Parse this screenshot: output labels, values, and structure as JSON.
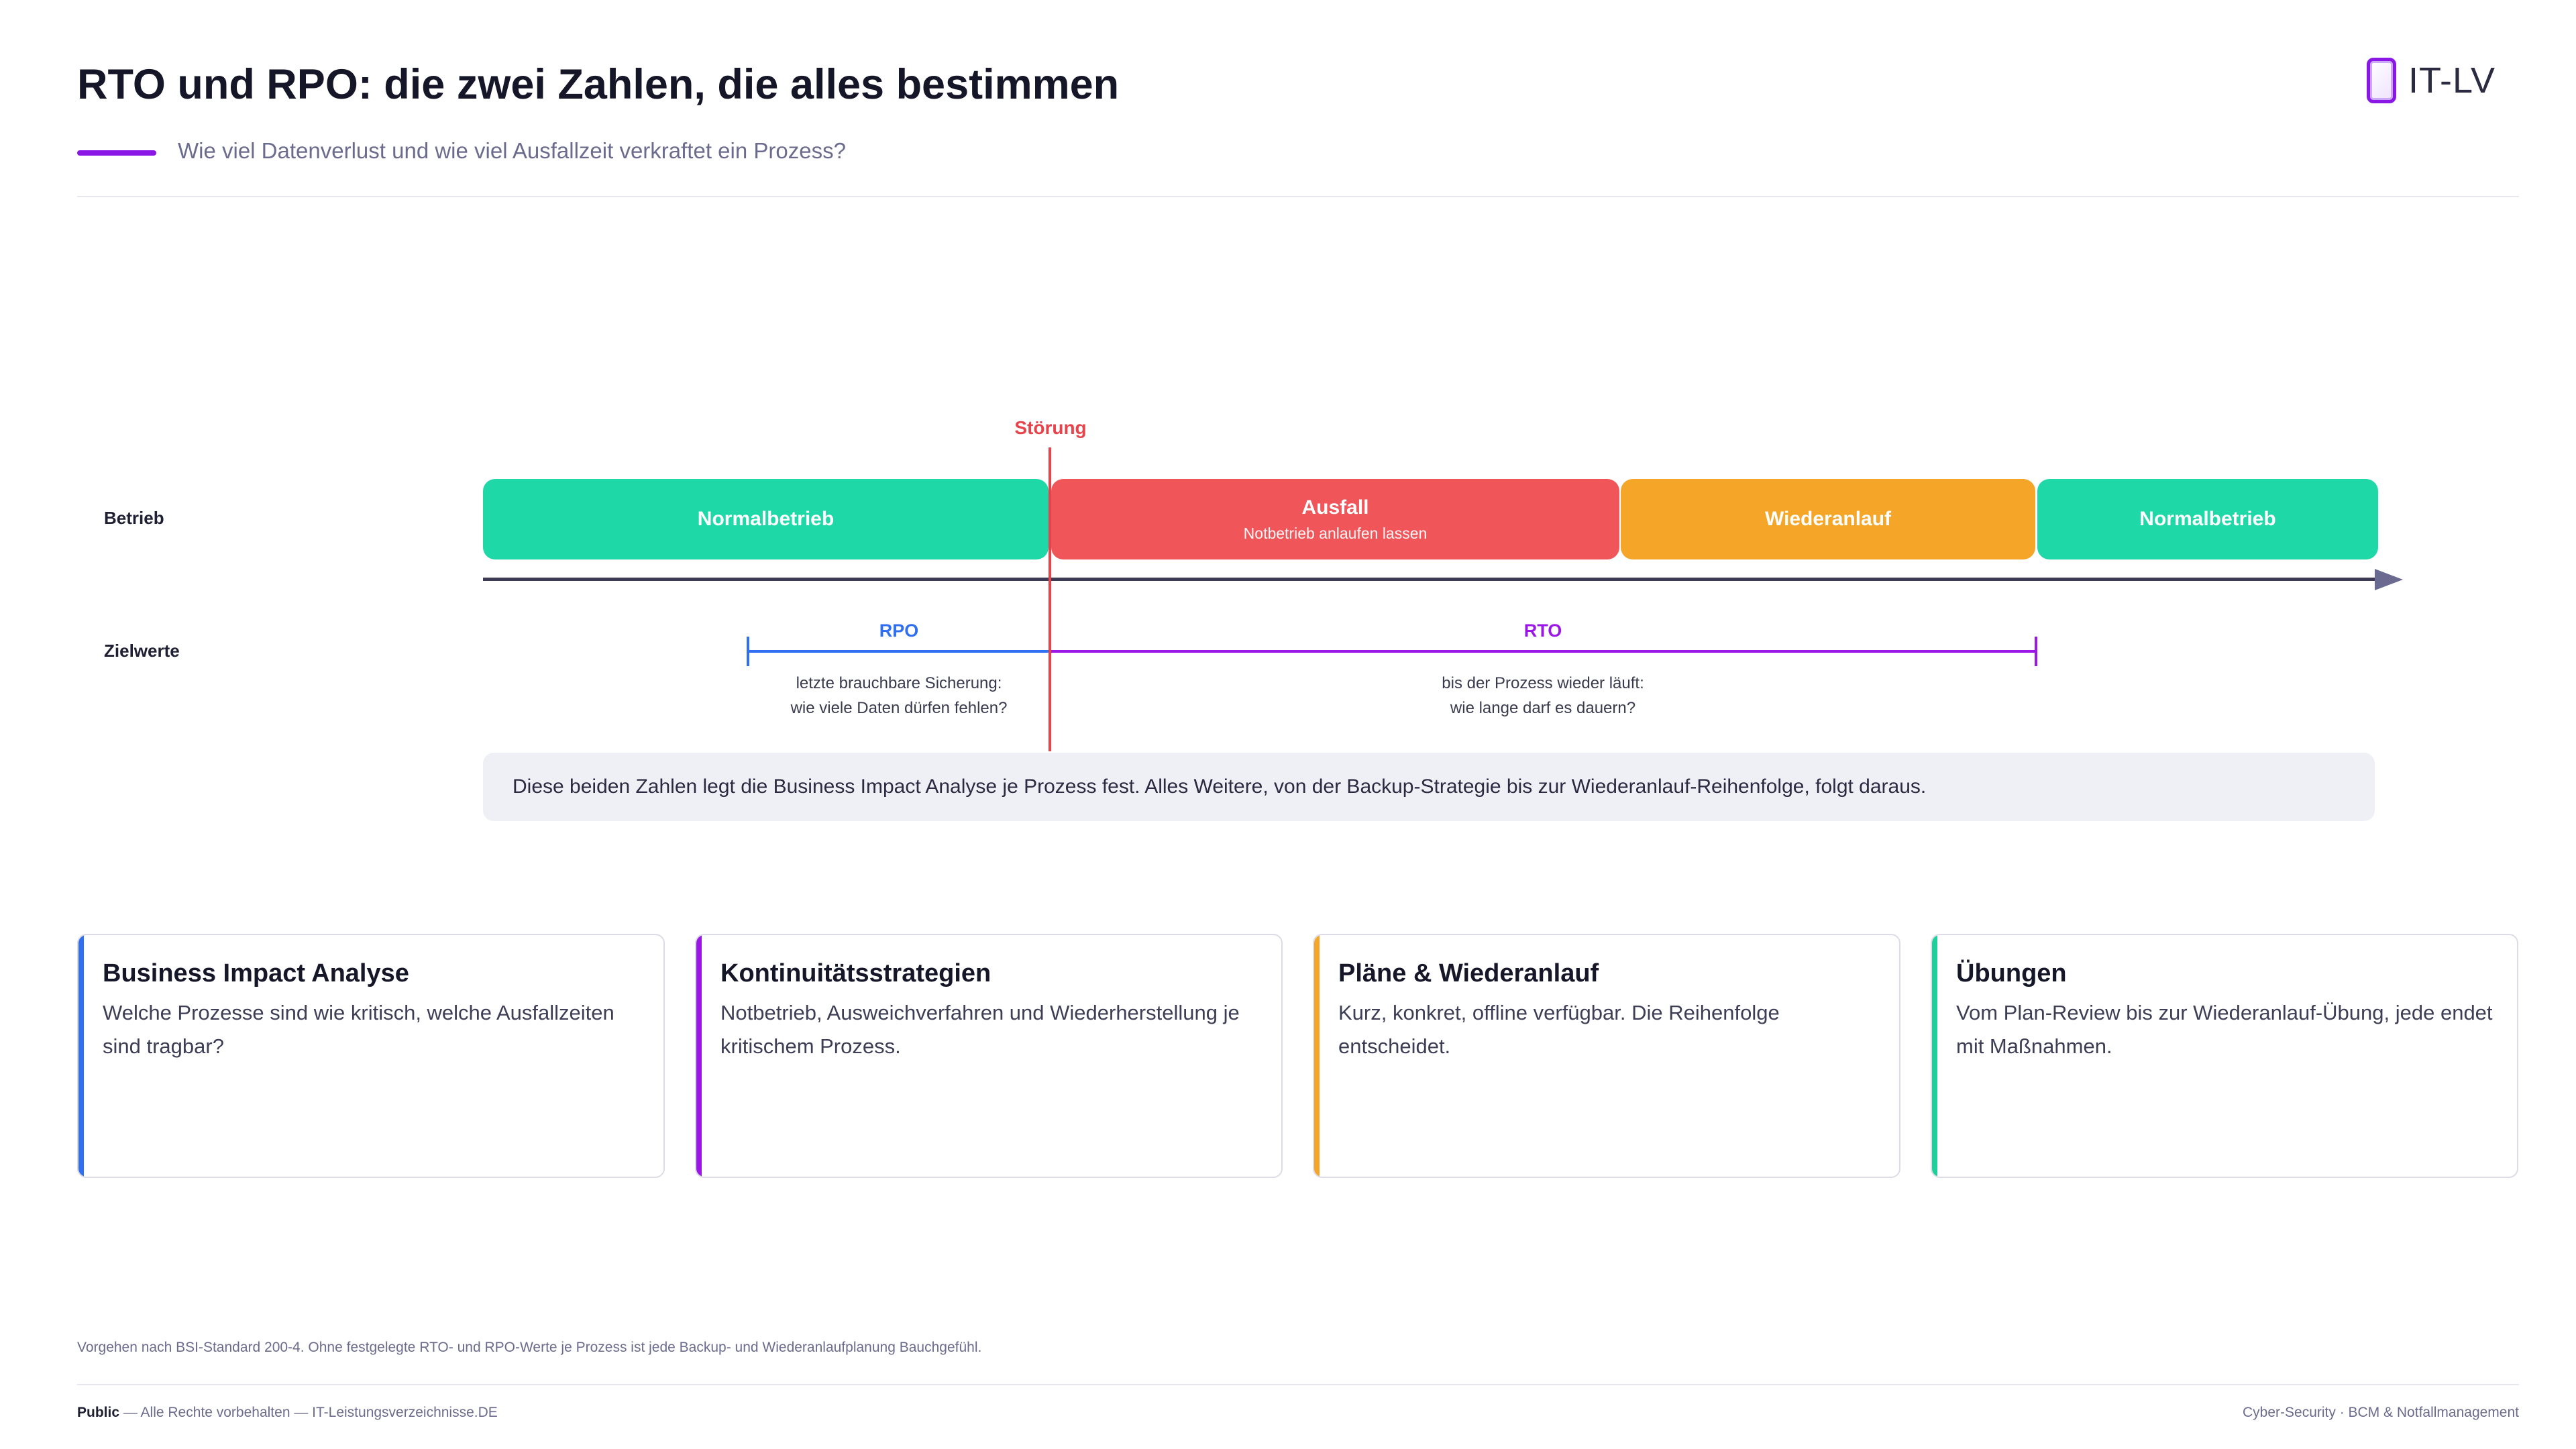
{
  "header": {
    "title": "RTO und RPO: die zwei Zahlen, die alles bestimmen",
    "subtitle": "Wie viel Datenverlust und wie viel Ausfallzeit verkraftet ein Prozess?",
    "logo_text": "IT-LV",
    "accent_color": "#8a17e6"
  },
  "timeline": {
    "row_betrieb": "Betrieb",
    "row_zielwerte": "Zielwerte",
    "event_label": "Störung",
    "phases": [
      {
        "label": "Normalbetrieb",
        "sub": "",
        "color": "#1ed9a7"
      },
      {
        "label": "Ausfall",
        "sub": "Notbetrieb anlaufen lassen",
        "color": "#f0555a"
      },
      {
        "label": "Wiederanlauf",
        "sub": "",
        "color": "#f5a528"
      },
      {
        "label": "Normalbetrieb",
        "sub": "",
        "color": "#1ed9a7"
      }
    ],
    "rpo": {
      "label": "RPO",
      "color": "#2f6ff0",
      "desc_line1": "letzte brauchbare Sicherung:",
      "desc_line2": "wie viele Daten dürfen fehlen?"
    },
    "rto": {
      "label": "RTO",
      "color": "#9b17e6",
      "desc_line1": "bis der Prozess wieder läuft:",
      "desc_line2": "wie lange darf es dauern?"
    },
    "note": "Diese beiden Zahlen legt die Business Impact Analyse je Prozess fest. Alles Weitere, von der Backup-Strategie bis zur Wiederanlauf-Reihenfolge, folgt daraus."
  },
  "cards": [
    {
      "title": "Business Impact Analyse",
      "text": "Welche Prozesse sind wie kritisch, welche Ausfallzeiten sind tragbar?",
      "color": "#2f6ff0"
    },
    {
      "title": "Kontinuitätsstrategien",
      "text": "Notbetrieb, Ausweichverfahren und Wiederherstellung je kritischem Prozess.",
      "color": "#9b17e6"
    },
    {
      "title": "Pläne & Wiederanlauf",
      "text": "Kurz, konkret, offline verfügbar. Die Reihenfolge entscheidet.",
      "color": "#f5a528"
    },
    {
      "title": "Übungen",
      "text": "Vom Plan-Review bis zur Wiederanlauf-Übung, jede endet mit Maßnahmen.",
      "color": "#1ecf9c"
    }
  ],
  "footnote": "Vorgehen nach BSI-Standard 200-4. Ohne festgelegte RTO- und RPO-Werte je Prozess ist jede Backup- und Wiederanlaufplanung Bauchgefühl.",
  "footer": {
    "classification": "Public",
    "rights": " — Alle Rechte vorbehalten — IT-Leistungsverzeichnisse.DE",
    "right_text": "Cyber-Security · BCM & Notfallmanagement"
  }
}
